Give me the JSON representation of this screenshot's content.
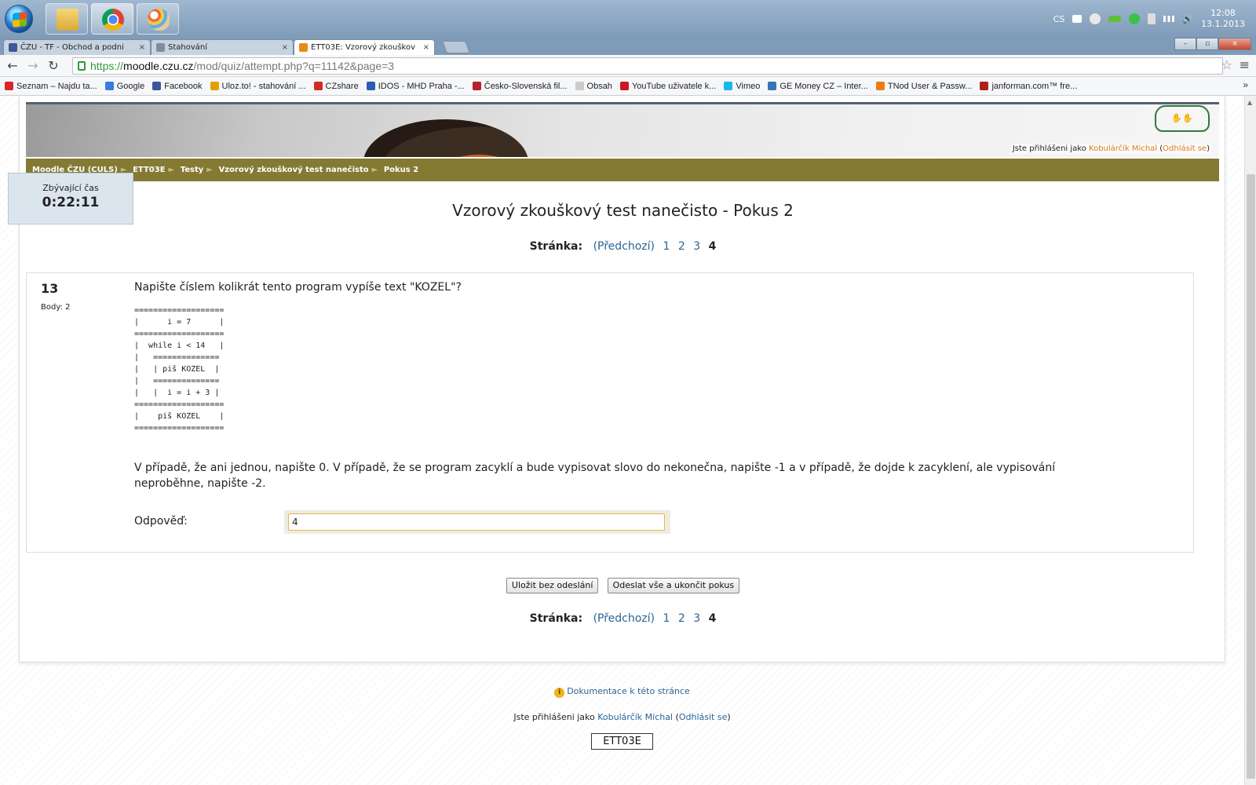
{
  "taskbar": {
    "clock_time": "12:08",
    "clock_date": "13.1.2013",
    "lang": "CS"
  },
  "tabs": [
    {
      "label": "ČZU - TF - Obchod a podni"
    },
    {
      "label": "Stahování"
    },
    {
      "label": "ETT03E: Vzorový zkouškov"
    }
  ],
  "omnibox": {
    "scheme": "https://",
    "host": "moodle.czu.cz",
    "path": "/mod/quiz/attempt.php?q=11142&page=3"
  },
  "bookmarks": [
    {
      "label": "Seznam – Najdu ta...",
      "color": "#d8262d"
    },
    {
      "label": "Google",
      "color": "#3a7be0"
    },
    {
      "label": "Facebook",
      "color": "#3b5998"
    },
    {
      "label": "Uloz.to! - stahování ...",
      "color": "#e0a100"
    },
    {
      "label": "CZshare",
      "color": "#d12b20"
    },
    {
      "label": "IDOS - MHD Praha -...",
      "color": "#2a5db0"
    },
    {
      "label": "Česko-Slovenská fil...",
      "color": "#b5202a"
    },
    {
      "label": "Obsah",
      "color": "#cccccc"
    },
    {
      "label": "YouTube uživatele k...",
      "color": "#cc181e"
    },
    {
      "label": "Vimeo",
      "color": "#1ab7ea"
    },
    {
      "label": "GE Money CZ – Inter...",
      "color": "#3b73b9"
    },
    {
      "label": "TNod User & Passw...",
      "color": "#f07a1a"
    },
    {
      "label": "janforman.com™ fre...",
      "color": "#b0201c"
    }
  ],
  "header": {
    "login_prefix": "Jste přihlášeni jako",
    "user": "Kobulárčík Michal",
    "logout": "Odhlásit se"
  },
  "breadcrumb": [
    "Moodle ČZU (CULS)",
    "ETT03E",
    "Testy",
    "Vzorový zkouškový test nanečisto",
    "Pokus 2"
  ],
  "timer": {
    "label": "Zbývající čas",
    "value": "0:22:11"
  },
  "quiz": {
    "title": "Vzorový zkouškový test nanečisto - Pokus 2",
    "pager_label": "Stránka:",
    "pager_prev": "(Předchozí)",
    "pages": [
      "1",
      "2",
      "3"
    ],
    "current_page": "4"
  },
  "question": {
    "number": "13",
    "points": "Body: 2",
    "text": "Napište číslem kolikrát tento program vypíše text \"KOZEL\"?",
    "code": "===================\n|      i = 7      |\n===================\n|  while i < 14   |\n|   ==============\n|   | piš KOZEL  |\n|   ==============\n|   |  i = i + 3 |\n===================\n|    piš KOZEL    |\n===================",
    "note": "V případě, že ani jednou, napište 0. V případě, že se program zacyklí a bude vypisovat slovo do nekonečna, napište -1 a v případě, že dojde k zacyklení, ale vypisování neproběhne, napište -2.",
    "answer_label": "Odpověď:",
    "answer_value": "4"
  },
  "actions": {
    "save": "Uložit bez odeslání",
    "submit": "Odeslat vše a ukončit pokus"
  },
  "footer": {
    "doc_link": "Dokumentace k této stránce",
    "login_prefix": "Jste přihlášeni jako",
    "user": "Kobulárčík Michal",
    "logout": "Odhlásit se",
    "course": "ETT03E"
  }
}
